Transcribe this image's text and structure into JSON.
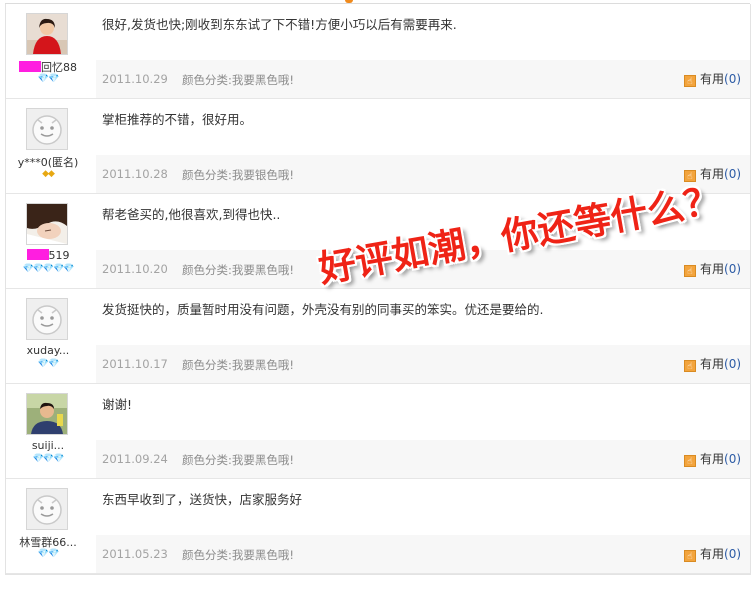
{
  "promo_text": "好评如潮，你还等什么？",
  "useful_label": "有用",
  "colors": {
    "promo": "#ef2316",
    "mask": "#ff1ee0",
    "link": "#2d5ca6"
  },
  "reviews": [
    {
      "avatar": "photo-woman-red",
      "username_prefix_masked": true,
      "username": "回忆88",
      "badges": "💎💎",
      "badge_type": "heart",
      "content": "很好,发货也快;刚收到东东试了下不错!方便小巧以后有需要再来.",
      "date": "2011.10.29",
      "sku": "颜色分类:我要黑色哦!",
      "useful_count": "(0)"
    },
    {
      "avatar": "default-smiley",
      "username_prefix_masked": false,
      "username": "y***0(匿名)",
      "badges": "◆◆",
      "badge_type": "diamond",
      "content": "掌柜推荐的不错，很好用。",
      "date": "2011.10.28",
      "sku": "颜色分类:我要银色哦!",
      "useful_count": "(0)"
    },
    {
      "avatar": "photo-girl",
      "username_prefix_masked": true,
      "username": "519",
      "badges": "💎💎💎💎💎",
      "badge_type": "heart",
      "content": "帮老爸买的,他很喜欢,到得也快..",
      "date": "2011.10.20",
      "sku": "颜色分类:我要黑色哦!",
      "useful_count": "(0)"
    },
    {
      "avatar": "default-smiley",
      "username_prefix_masked": false,
      "username": "xuday...",
      "badges": "💎💎",
      "badge_type": "heart",
      "content": "发货挺快的，质量暂时用没有问题，外壳没有别的同事买的笨实。优还是要给的.",
      "date": "2011.10.17",
      "sku": "颜色分类:我要黑色哦!",
      "useful_count": "(0)"
    },
    {
      "avatar": "photo-man",
      "username_prefix_masked": false,
      "username": "suiji...",
      "badges": "💎💎💎",
      "badge_type": "heart",
      "content": "谢谢!",
      "date": "2011.09.24",
      "sku": "颜色分类:我要黑色哦!",
      "useful_count": "(0)"
    },
    {
      "avatar": "default-smiley",
      "username_prefix_masked": false,
      "username": "林雪群66...",
      "badges": "💎💎",
      "badge_type": "heart",
      "content": "东西早收到了，送货快，店家服务好",
      "date": "2011.05.23",
      "sku": "颜色分类:我要黑色哦!",
      "useful_count": "(0)"
    }
  ]
}
